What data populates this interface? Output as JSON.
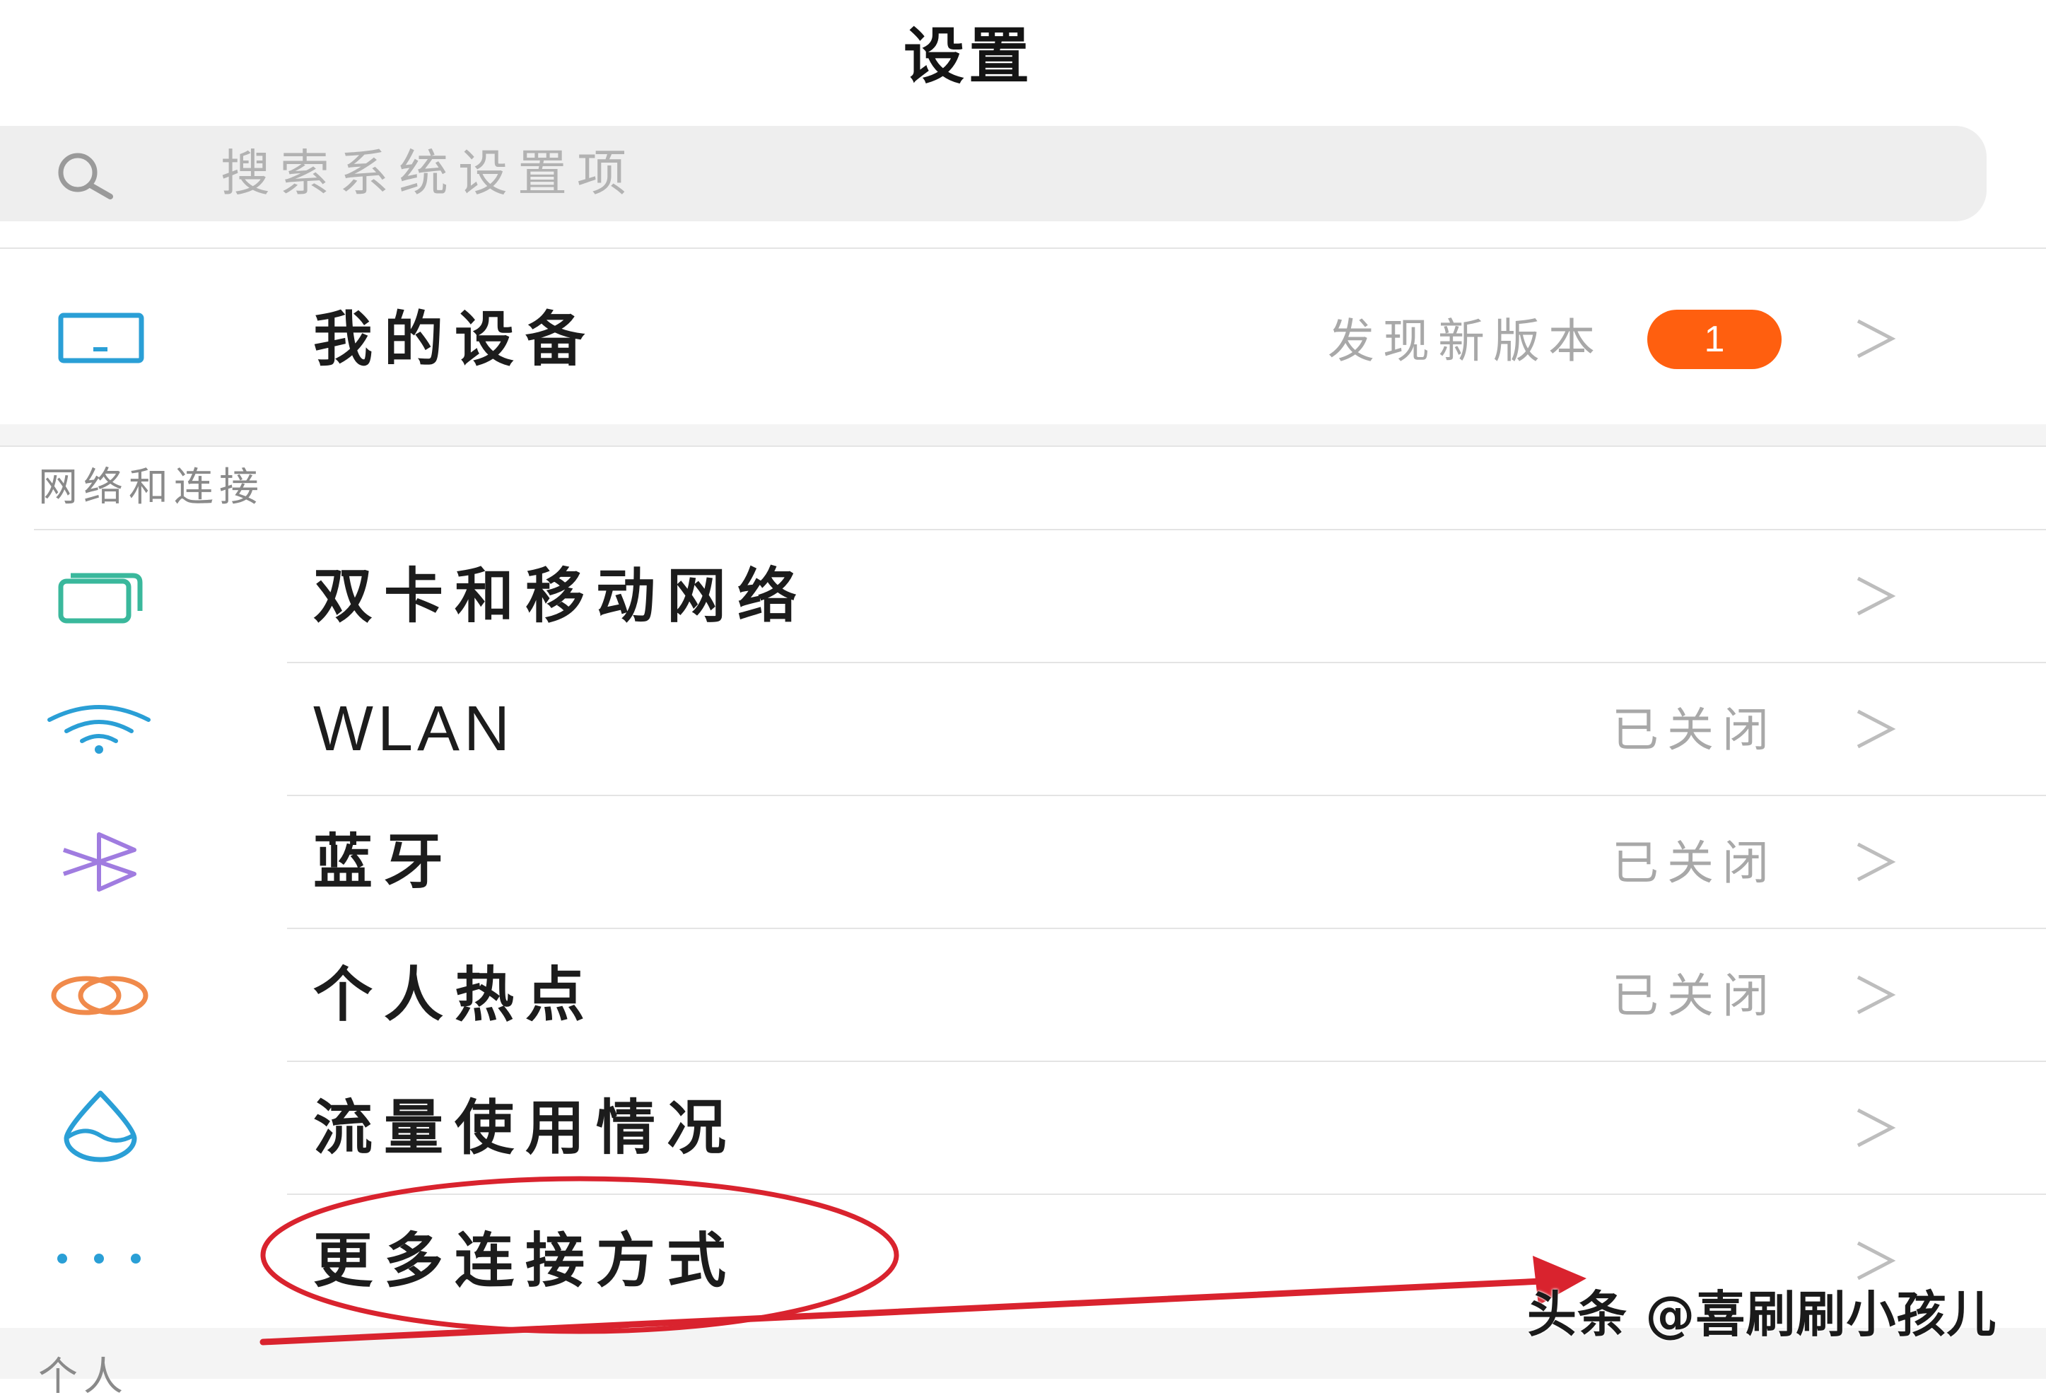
{
  "header": {
    "title": "设置"
  },
  "search": {
    "placeholder": "搜索系统设置项",
    "icon": "search-icon"
  },
  "device": {
    "label": "我的设备",
    "value": "发现新版本",
    "badge": "1",
    "icon": "tablet-icon",
    "chevron": ">"
  },
  "network_section": {
    "header": "网络和连接",
    "items": [
      {
        "label": "双卡和移动网络",
        "value": "",
        "icon": "dual-sim-icon",
        "chevron": ">",
        "icon_color": "#3ab89c"
      },
      {
        "label": "WLAN",
        "value": "已关闭",
        "icon": "wifi-icon",
        "chevron": ">",
        "icon_color": "#2a9fd6"
      },
      {
        "label": "蓝牙",
        "value": "已关闭",
        "icon": "bluetooth-icon",
        "chevron": ">",
        "icon_color": "#a07ce0"
      },
      {
        "label": "个人热点",
        "value": "已关闭",
        "icon": "hotspot-icon",
        "chevron": ">",
        "icon_color": "#f08a4b"
      },
      {
        "label": "流量使用情况",
        "value": "",
        "icon": "data-usage-icon",
        "chevron": ">",
        "icon_color": "#2a9fd6"
      },
      {
        "label": "更多连接方式",
        "value": "",
        "icon": "more-dots-icon",
        "chevron": ">",
        "icon_color": "#2a9fd6"
      }
    ]
  },
  "next_section": {
    "header": "个人"
  },
  "watermark": "头条 @喜刷刷小孩儿",
  "colors": {
    "badge": "#ff5f0f",
    "annotation": "#d9232e",
    "accent": "#2a9fd6"
  }
}
